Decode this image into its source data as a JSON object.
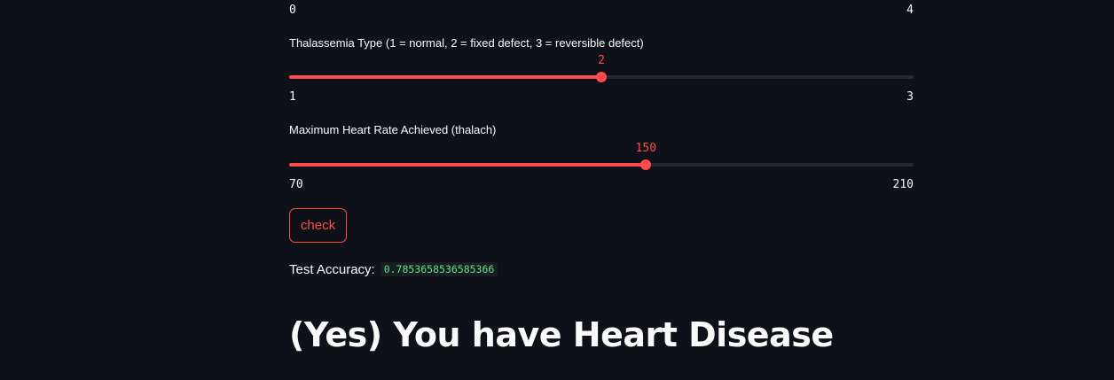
{
  "previous_slider": {
    "min_label": "0",
    "max_label": "4"
  },
  "sliders": [
    {
      "label": "Thalassemia Type (1 = normal, 2 = fixed defect, 3 = reversible defect)",
      "min": 1,
      "max": 3,
      "value": 2,
      "min_label": "1",
      "max_label": "3",
      "value_label": "2"
    },
    {
      "label": "Maximum Heart Rate Achieved (thalach)",
      "min": 70,
      "max": 210,
      "value": 150,
      "min_label": "70",
      "max_label": "210",
      "value_label": "150"
    }
  ],
  "check_button": {
    "label": "check"
  },
  "accuracy": {
    "label": "Test Accuracy:",
    "value": "0.7853658536585366"
  },
  "result": {
    "heading": "(Yes) You have Heart Disease"
  },
  "colors": {
    "background": "#0e1117",
    "accent": "#ff4b4b",
    "track": "#262730",
    "text": "#fafafa",
    "code_text": "#5ce488"
  }
}
